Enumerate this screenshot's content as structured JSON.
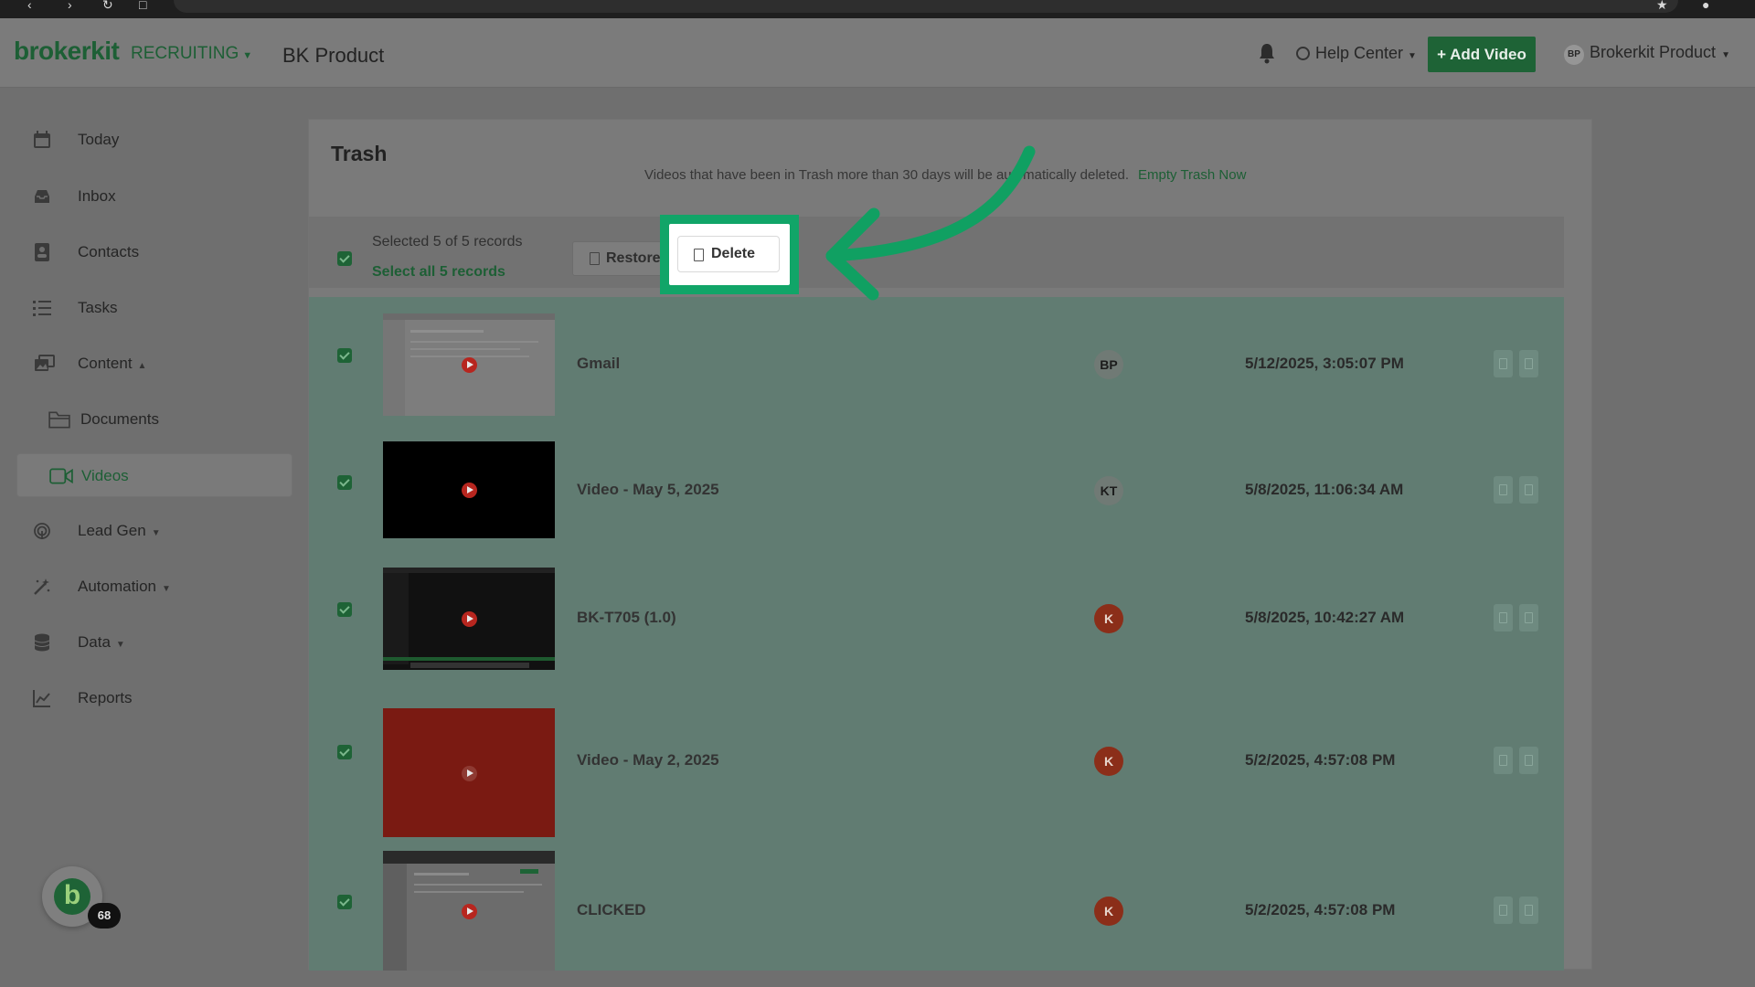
{
  "header": {
    "brand": "brokerkit",
    "module": "RECRUITING",
    "workspace": "BK Product",
    "help_center": "Help Center",
    "add_video": "+ Add Video",
    "user_initials": "BP",
    "user_name": "Brokerkit Product"
  },
  "sidebar": {
    "items": [
      {
        "label": "Today"
      },
      {
        "label": "Inbox"
      },
      {
        "label": "Contacts"
      },
      {
        "label": "Tasks"
      },
      {
        "label": "Content"
      },
      {
        "label": "Documents"
      },
      {
        "label": "Videos"
      },
      {
        "label": "Lead Gen"
      },
      {
        "label": "Automation"
      },
      {
        "label": "Data"
      },
      {
        "label": "Reports"
      }
    ],
    "bubble_letter": "b",
    "notification_count": "68"
  },
  "trash": {
    "title": "Trash",
    "notice": "Videos that have been in Trash more than 30 days will be automatically deleted.",
    "empty_link": "Empty Trash Now",
    "selected_text": "Selected 5 of 5 records",
    "select_all": "Select all 5 records",
    "restore_label": "Restore",
    "delete_label": "Delete"
  },
  "videos": [
    {
      "title": "Gmail",
      "owner": "BP",
      "date": "5/12/2025, 3:05:07 PM",
      "thumb_color": "#7d7d7d"
    },
    {
      "title": "Video - May 5, 2025",
      "owner": "KT",
      "date": "5/8/2025, 11:06:34 AM",
      "thumb_color": "#000000"
    },
    {
      "title": "BK-T705 (1.0)",
      "owner": "K",
      "date": "5/8/2025, 10:42:27 AM",
      "thumb_color": "#111111"
    },
    {
      "title": "Video - May 2, 2025",
      "owner": "K",
      "date": "5/2/2025, 4:57:08 PM",
      "thumb_color": "#7a1a12"
    },
    {
      "title": "CLICKED",
      "owner": "K",
      "date": "5/2/2025, 4:57:08 PM",
      "thumb_color": "#6c6c6c"
    }
  ],
  "colors": {
    "brand_green": "#1e6336",
    "highlight": "#11a568",
    "annotation_arrow": "#10a062"
  }
}
